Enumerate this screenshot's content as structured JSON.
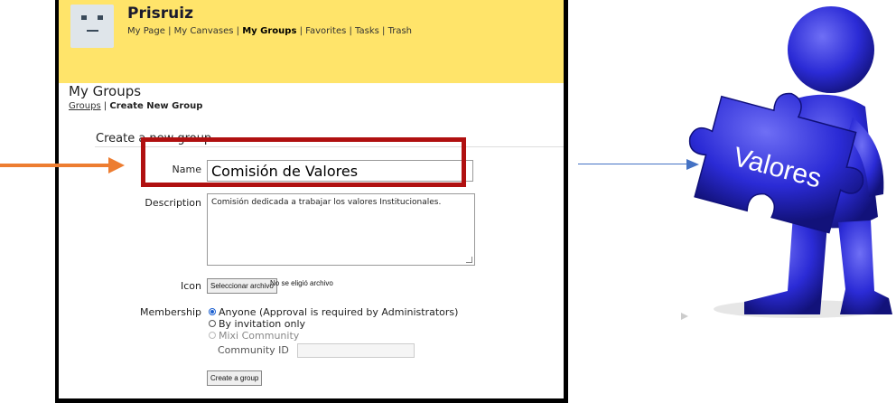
{
  "app": {
    "site_name": "Prisruiz",
    "nav": [
      {
        "label": "My Page",
        "active": false
      },
      {
        "label": "My Canvases",
        "active": false
      },
      {
        "label": "My Groups",
        "active": true
      },
      {
        "label": "Favorites",
        "active": false
      },
      {
        "label": "Tasks",
        "active": false
      },
      {
        "label": "Trash",
        "active": false
      }
    ],
    "nav_separator": " | "
  },
  "page": {
    "title": "My Groups",
    "breadcrumb_link": "Groups",
    "breadcrumb_sep": " | ",
    "breadcrumb_current": "Create New Group",
    "section_title": "Create a new group"
  },
  "form": {
    "name_label": "Name",
    "name_value": "Comisión de Valores",
    "description_label": "Description",
    "description_value": "Comisión dedicada a trabajar los valores Institucionales.",
    "icon_label": "Icon",
    "file_button": "Seleccionar archivo",
    "file_status": "No se eligió archivo",
    "membership_label": "Membership",
    "membership_options": [
      {
        "label": "Anyone (Approval is required by Administrators)",
        "selected": true,
        "disabled": false
      },
      {
        "label": "By invitation only",
        "selected": false,
        "disabled": false
      },
      {
        "label": "Mixi Community",
        "selected": false,
        "disabled": true
      }
    ],
    "community_id_label": "Community ID",
    "community_id_value": "",
    "submit_label": "Create a group"
  },
  "illustration": {
    "puzzle_text": "Valores",
    "figure_color": "#2b2bd6"
  },
  "colors": {
    "header_bg": "#ffe46a",
    "highlight_box": "#b01010",
    "arrow_left": "#ed7d31",
    "arrow_right": "#4472c4"
  }
}
